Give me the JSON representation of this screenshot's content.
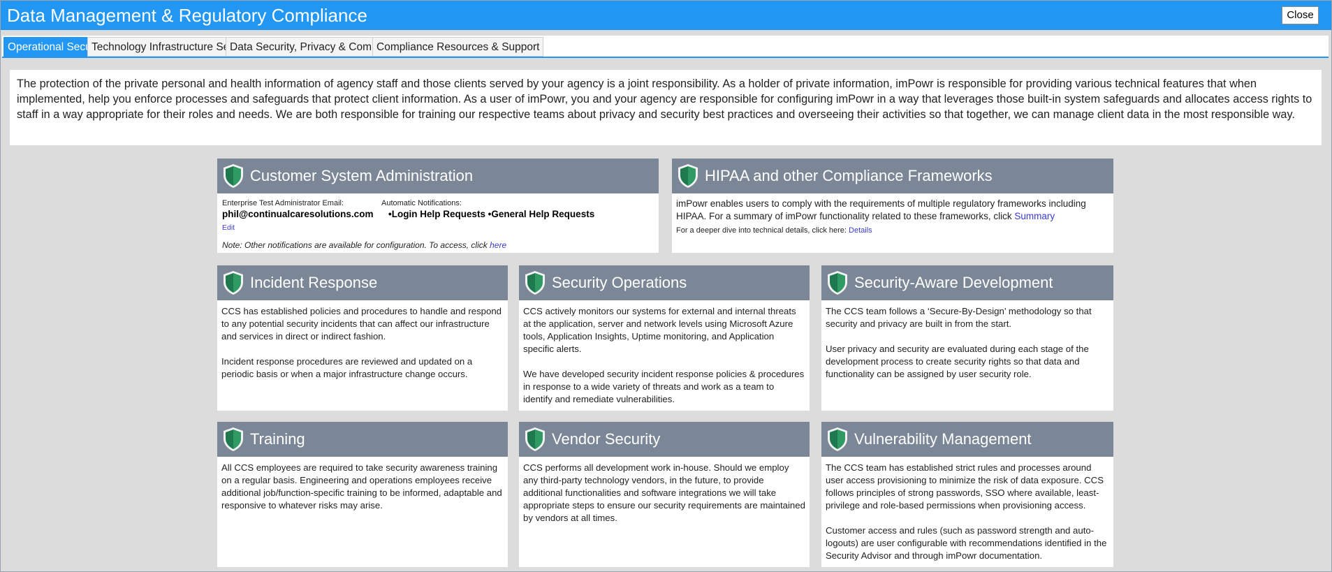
{
  "window": {
    "title": "Data Management & Regulatory Compliance",
    "close_label": "Close"
  },
  "tabs": [
    {
      "label": "Operational Security",
      "active": true
    },
    {
      "label": "Technology Infrastructure Security",
      "active": false
    },
    {
      "label": "Data Security, Privacy & Compliance",
      "active": false
    },
    {
      "label": "Compliance Resources & Support",
      "active": false
    }
  ],
  "intro": "The protection of the private personal and health information of agency staff and those clients served by your agency is a joint responsibility. As a holder of private information, imPowr is responsible for providing various technical features that when implemented, help you enforce processes and safeguards that protect client information. As a user of imPowr, you and your agency are responsible for configuring imPowr in a way that leverages those built-in system safeguards and allocates access rights to staff in a way appropriate for their roles and needs. We are both responsible for training our respective teams about privacy and security best practices and overseeing their activities so that together, we can manage client data in the most responsible way.",
  "admin": {
    "title": "Customer System Administration",
    "email_label": "Enterprise Test Administrator Email:",
    "email": "phil@continualcaresolutions.com",
    "edit_label": "Edit",
    "notif_label": "Automatic Notifications:",
    "notif_items": [
      "•Login Help Requests",
      "•General Help Requests"
    ],
    "note_text": "Note: Other notifications are available for configuration. To access, click ",
    "note_link": "here"
  },
  "hipaa": {
    "title": "HIPAA and other Compliance Frameworks",
    "text": "imPowr enables users to comply with the requirements of multiple regulatory frameworks including HIPAA. For a summary of imPowr functionality related to these frameworks, click ",
    "summary_link": "Summary",
    "detail_text": "For a deeper dive into technical details, click here: ",
    "details_link": "Details"
  },
  "cards": [
    {
      "title": "Incident Response",
      "paragraphs": [
        "CCS has established policies and procedures to handle and respond to any potential security incidents that can affect our infrastructure and services in direct or indirect fashion.",
        "Incident response procedures are reviewed and updated on a periodic basis or when a major infrastructure change occurs."
      ]
    },
    {
      "title": "Security Operations",
      "paragraphs": [
        "CCS actively monitors our systems for external and internal threats at the application, server and network levels using Microsoft Azure tools, Application Insights, Uptime monitoring, and Application specific alerts.",
        "We have developed security incident response policies & procedures in response to a wide variety of threats and work as a team to identify and remediate vulnerabilities."
      ]
    },
    {
      "title": "Security-Aware Development",
      "paragraphs": [
        "The CCS team follows a ‘Secure-By-Design’ methodology so that security and privacy are built in from the start.",
        "User privacy and security are evaluated during each stage of the development process to create security rights so that data and functionality can be assigned by user security role."
      ]
    },
    {
      "title": "Training",
      "paragraphs": [
        "All CCS employees are required to take security awareness training on a regular basis. Engineering and operations employees receive additional job/function-specific training to be informed, adaptable and responsive to whatever risks may arise."
      ]
    },
    {
      "title": "Vendor Security",
      "paragraphs": [
        "CCS performs all development work in-house. Should we employ any third-party technology vendors, in the future, to provide additional functionalities and software integrations we will take appropriate steps to ensure our security requirements are maintained by vendors at all times."
      ]
    },
    {
      "title": "Vulnerability Management",
      "paragraphs": [
        "The CCS team has established strict rules and processes around user access provisioning to minimize the risk of data exposure. CCS follows principles of strong passwords, SSO where available, least-privilege and role-based permissions when provisioning access.",
        "Customer access and rules (such as password strength and auto-logouts) are user configurable with recommendations identified in the Security Advisor and through imPowr documentation."
      ]
    }
  ],
  "colors": {
    "accent": "#2196f3",
    "card_header": "#7b8796",
    "shield": "#1e7a4e",
    "background": "#dcdcdc",
    "link": "#3a3ad0"
  },
  "icons": {
    "card_header": "shield-icon",
    "close": "close-button"
  }
}
